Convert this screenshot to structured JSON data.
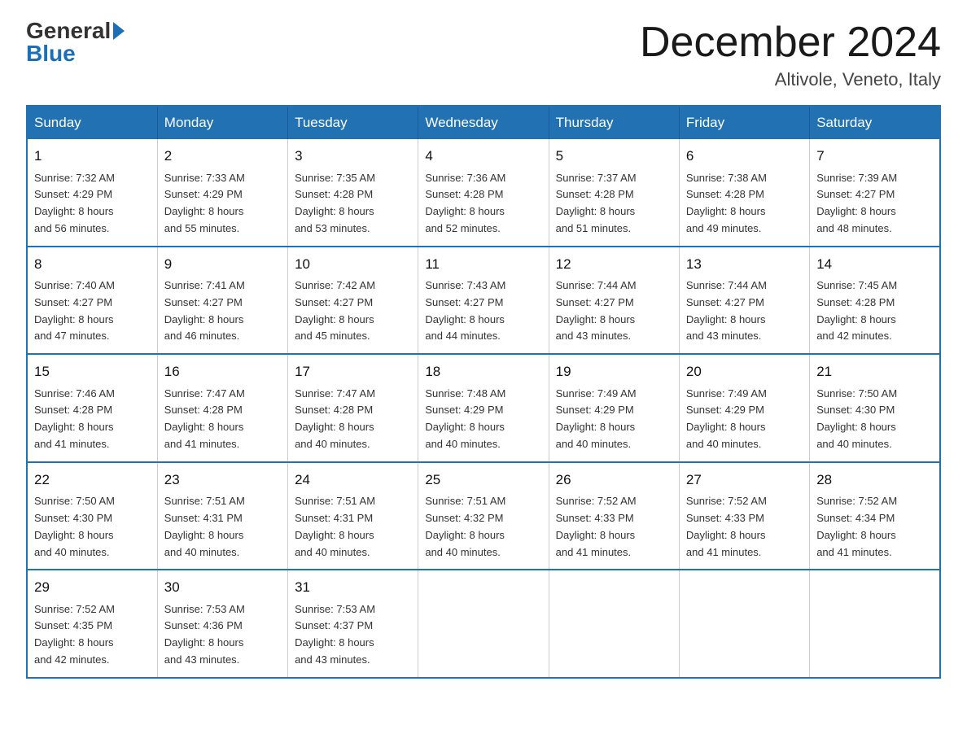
{
  "logo": {
    "general": "General",
    "blue": "Blue"
  },
  "title": "December 2024",
  "location": "Altivole, Veneto, Italy",
  "days_of_week": [
    "Sunday",
    "Monday",
    "Tuesday",
    "Wednesday",
    "Thursday",
    "Friday",
    "Saturday"
  ],
  "weeks": [
    [
      {
        "day": "1",
        "sunrise": "7:32 AM",
        "sunset": "4:29 PM",
        "daylight": "8 hours and 56 minutes."
      },
      {
        "day": "2",
        "sunrise": "7:33 AM",
        "sunset": "4:29 PM",
        "daylight": "8 hours and 55 minutes."
      },
      {
        "day": "3",
        "sunrise": "7:35 AM",
        "sunset": "4:28 PM",
        "daylight": "8 hours and 53 minutes."
      },
      {
        "day": "4",
        "sunrise": "7:36 AM",
        "sunset": "4:28 PM",
        "daylight": "8 hours and 52 minutes."
      },
      {
        "day": "5",
        "sunrise": "7:37 AM",
        "sunset": "4:28 PM",
        "daylight": "8 hours and 51 minutes."
      },
      {
        "day": "6",
        "sunrise": "7:38 AM",
        "sunset": "4:28 PM",
        "daylight": "8 hours and 49 minutes."
      },
      {
        "day": "7",
        "sunrise": "7:39 AM",
        "sunset": "4:27 PM",
        "daylight": "8 hours and 48 minutes."
      }
    ],
    [
      {
        "day": "8",
        "sunrise": "7:40 AM",
        "sunset": "4:27 PM",
        "daylight": "8 hours and 47 minutes."
      },
      {
        "day": "9",
        "sunrise": "7:41 AM",
        "sunset": "4:27 PM",
        "daylight": "8 hours and 46 minutes."
      },
      {
        "day": "10",
        "sunrise": "7:42 AM",
        "sunset": "4:27 PM",
        "daylight": "8 hours and 45 minutes."
      },
      {
        "day": "11",
        "sunrise": "7:43 AM",
        "sunset": "4:27 PM",
        "daylight": "8 hours and 44 minutes."
      },
      {
        "day": "12",
        "sunrise": "7:44 AM",
        "sunset": "4:27 PM",
        "daylight": "8 hours and 43 minutes."
      },
      {
        "day": "13",
        "sunrise": "7:44 AM",
        "sunset": "4:27 PM",
        "daylight": "8 hours and 43 minutes."
      },
      {
        "day": "14",
        "sunrise": "7:45 AM",
        "sunset": "4:28 PM",
        "daylight": "8 hours and 42 minutes."
      }
    ],
    [
      {
        "day": "15",
        "sunrise": "7:46 AM",
        "sunset": "4:28 PM",
        "daylight": "8 hours and 41 minutes."
      },
      {
        "day": "16",
        "sunrise": "7:47 AM",
        "sunset": "4:28 PM",
        "daylight": "8 hours and 41 minutes."
      },
      {
        "day": "17",
        "sunrise": "7:47 AM",
        "sunset": "4:28 PM",
        "daylight": "8 hours and 40 minutes."
      },
      {
        "day": "18",
        "sunrise": "7:48 AM",
        "sunset": "4:29 PM",
        "daylight": "8 hours and 40 minutes."
      },
      {
        "day": "19",
        "sunrise": "7:49 AM",
        "sunset": "4:29 PM",
        "daylight": "8 hours and 40 minutes."
      },
      {
        "day": "20",
        "sunrise": "7:49 AM",
        "sunset": "4:29 PM",
        "daylight": "8 hours and 40 minutes."
      },
      {
        "day": "21",
        "sunrise": "7:50 AM",
        "sunset": "4:30 PM",
        "daylight": "8 hours and 40 minutes."
      }
    ],
    [
      {
        "day": "22",
        "sunrise": "7:50 AM",
        "sunset": "4:30 PM",
        "daylight": "8 hours and 40 minutes."
      },
      {
        "day": "23",
        "sunrise": "7:51 AM",
        "sunset": "4:31 PM",
        "daylight": "8 hours and 40 minutes."
      },
      {
        "day": "24",
        "sunrise": "7:51 AM",
        "sunset": "4:31 PM",
        "daylight": "8 hours and 40 minutes."
      },
      {
        "day": "25",
        "sunrise": "7:51 AM",
        "sunset": "4:32 PM",
        "daylight": "8 hours and 40 minutes."
      },
      {
        "day": "26",
        "sunrise": "7:52 AM",
        "sunset": "4:33 PM",
        "daylight": "8 hours and 41 minutes."
      },
      {
        "day": "27",
        "sunrise": "7:52 AM",
        "sunset": "4:33 PM",
        "daylight": "8 hours and 41 minutes."
      },
      {
        "day": "28",
        "sunrise": "7:52 AM",
        "sunset": "4:34 PM",
        "daylight": "8 hours and 41 minutes."
      }
    ],
    [
      {
        "day": "29",
        "sunrise": "7:52 AM",
        "sunset": "4:35 PM",
        "daylight": "8 hours and 42 minutes."
      },
      {
        "day": "30",
        "sunrise": "7:53 AM",
        "sunset": "4:36 PM",
        "daylight": "8 hours and 43 minutes."
      },
      {
        "day": "31",
        "sunrise": "7:53 AM",
        "sunset": "4:37 PM",
        "daylight": "8 hours and 43 minutes."
      },
      null,
      null,
      null,
      null
    ]
  ],
  "labels": {
    "sunrise": "Sunrise:",
    "sunset": "Sunset:",
    "daylight": "Daylight:"
  }
}
